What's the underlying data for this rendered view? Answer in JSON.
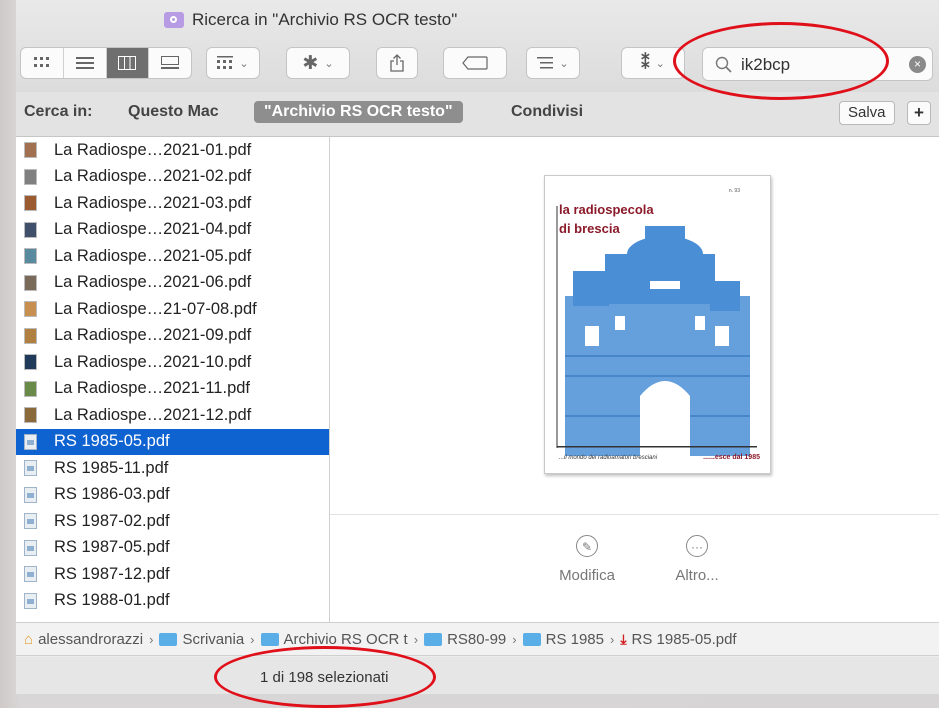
{
  "window": {
    "title": "Ricerca in \"Archivio RS OCR testo\""
  },
  "toolbar": {
    "accent_color": "#6f6f6f"
  },
  "search": {
    "value": "ik2bcp",
    "clear_glyph": "×"
  },
  "scope": {
    "label": "Cerca in:",
    "options": [
      "Questo Mac",
      "\"Archivio RS OCR testo\"",
      "Condivisi"
    ],
    "active_index": 1,
    "save_label": "Salva",
    "add_label": "+"
  },
  "files": [
    {
      "name": "La Radiospe…2021-01.pdf",
      "icon": "pdf-thumb-icon",
      "color": "#a07050"
    },
    {
      "name": "La Radiospe…2021-02.pdf",
      "icon": "pdf-thumb-icon",
      "color": "#808080"
    },
    {
      "name": "La Radiospe…2021-03.pdf",
      "icon": "pdf-thumb-icon",
      "color": "#9c5a30"
    },
    {
      "name": "La Radiospe…2021-04.pdf",
      "icon": "pdf-thumb-icon",
      "color": "#40506a"
    },
    {
      "name": "La Radiospe…2021-05.pdf",
      "icon": "pdf-thumb-icon",
      "color": "#5a8aa0"
    },
    {
      "name": "La Radiospe…2021-06.pdf",
      "icon": "pdf-thumb-icon",
      "color": "#7a6a5a"
    },
    {
      "name": "La Radiospe…21-07-08.pdf",
      "icon": "pdf-thumb-icon",
      "color": "#c89050"
    },
    {
      "name": "La Radiospe…2021-09.pdf",
      "icon": "pdf-thumb-icon",
      "color": "#b08040"
    },
    {
      "name": "La Radiospe…2021-10.pdf",
      "icon": "pdf-thumb-icon",
      "color": "#203a5a"
    },
    {
      "name": "La Radiospe…2021-11.pdf",
      "icon": "pdf-thumb-icon",
      "color": "#6a8a4a"
    },
    {
      "name": "La Radiospe…2021-12.pdf",
      "icon": "pdf-thumb-icon",
      "color": "#8a6a3a"
    },
    {
      "name": "RS 1985-05.pdf",
      "icon": "document-icon",
      "color": "#8fb0d0",
      "selected": true
    },
    {
      "name": "RS 1985-11.pdf",
      "icon": "document-icon",
      "color": "#8fb0d0"
    },
    {
      "name": "RS 1986-03.pdf",
      "icon": "document-icon",
      "color": "#9cc060"
    },
    {
      "name": "RS 1987-02.pdf",
      "icon": "document-icon",
      "color": "#8fb0d0"
    },
    {
      "name": "RS 1987-05.pdf",
      "icon": "document-icon",
      "color": "#8fb0d0"
    },
    {
      "name": "RS 1987-12.pdf",
      "icon": "document-icon",
      "color": "#8fb0d0"
    },
    {
      "name": "RS 1988-01.pdf",
      "icon": "document-icon",
      "color": "#8fb0d0"
    }
  ],
  "preview": {
    "cover_title": "la radiospecola\ndi brescia",
    "cover_footer_left": "...il mondo dei radioamatori bresciani",
    "cover_footer_right": "......esce dal 1985",
    "actions": [
      {
        "label": "Modifica",
        "icon": "markup-icon"
      },
      {
        "label": "Altro...",
        "icon": "more-icon"
      }
    ]
  },
  "pathbar": [
    {
      "label": "alessandrorazzi",
      "icon": "home-icon"
    },
    {
      "label": "Scrivania",
      "icon": "folder-icon"
    },
    {
      "label": "Archivio RS OCR t",
      "icon": "folder-icon"
    },
    {
      "label": "RS80-99",
      "icon": "folder-icon"
    },
    {
      "label": "RS 1985",
      "icon": "folder-icon"
    },
    {
      "label": "RS 1985-05.pdf",
      "icon": "pdf-icon"
    }
  ],
  "status": {
    "text": "1 di 198 selezionati"
  },
  "annotation_color": "#e0101a"
}
